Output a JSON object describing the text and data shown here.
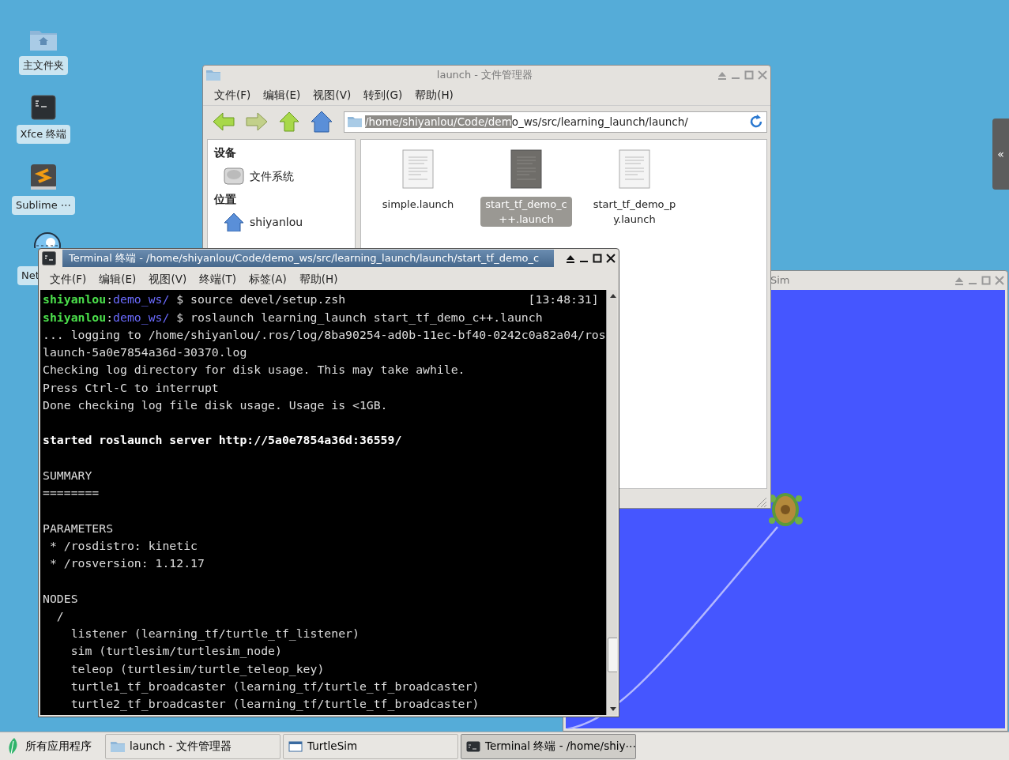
{
  "desktop_icons": [
    {
      "label": "主文件夹",
      "kind": "home"
    },
    {
      "label": "Xfce 终端",
      "kind": "terminal"
    },
    {
      "label": "Sublime ⋯",
      "kind": "sublime"
    },
    {
      "label": "Net",
      "kind": "network"
    }
  ],
  "panel_toggle": "«",
  "file_manager": {
    "title": "launch - 文件管理器",
    "menu": [
      "文件(F)",
      "编辑(E)",
      "视图(V)",
      "转到(G)",
      "帮助(H)"
    ],
    "path_selected": "/home/shiyanlou/Code/dem",
    "path_rest": "o_ws/src/learning_launch/launch/",
    "sidebar": [
      {
        "heading": "设备",
        "items": [
          {
            "label": "文件系统",
            "kind": "drive"
          }
        ]
      },
      {
        "heading": "位置",
        "items": [
          {
            "label": "shiyanlou",
            "kind": "home"
          }
        ]
      }
    ],
    "files": [
      {
        "name": "simple.launch",
        "selected": false
      },
      {
        "name": "start_tf_demo_c++.launch",
        "selected": true
      },
      {
        "name": "start_tf_demo_py.launch",
        "selected": false
      }
    ]
  },
  "turtlesim": {
    "title": "Sim"
  },
  "terminal": {
    "title": "Terminal 终端 - /home/shiyanlou/Code/demo_ws/src/learning_launch/launch/start_tf_demo_c",
    "menu": [
      "文件(F)",
      "编辑(E)",
      "视图(V)",
      "终端(T)",
      "标签(A)",
      "帮助(H)"
    ],
    "lines": [
      {
        "kind": "prompt",
        "user": "shiyanlou",
        "separator": ":",
        "dir": "demo_ws/",
        "command": "$ source devel/setup.zsh",
        "time": "[13:48:31]"
      },
      {
        "kind": "prompt",
        "user": "shiyanlou",
        "separator": ":",
        "dir": "demo_ws/",
        "command": "$ roslaunch learning_launch start_tf_demo_c++.launch"
      },
      {
        "kind": "text",
        "text": "... logging to /home/shiyanlou/.ros/log/8ba90254-ad0b-11ec-bf40-0242c0a82a04/ros"
      },
      {
        "kind": "text",
        "text": "launch-5a0e7854a36d-30370.log"
      },
      {
        "kind": "text",
        "text": "Checking log directory for disk usage. This may take awhile."
      },
      {
        "kind": "text",
        "text": "Press Ctrl-C to interrupt"
      },
      {
        "kind": "text",
        "text": "Done checking log file disk usage. Usage is <1GB."
      },
      {
        "kind": "blank"
      },
      {
        "kind": "bold",
        "text": "started roslaunch server http://5a0e7854a36d:36559/"
      },
      {
        "kind": "blank"
      },
      {
        "kind": "text",
        "text": "SUMMARY"
      },
      {
        "kind": "text",
        "text": "========"
      },
      {
        "kind": "blank"
      },
      {
        "kind": "text",
        "text": "PARAMETERS"
      },
      {
        "kind": "text",
        "text": " * /rosdistro: kinetic"
      },
      {
        "kind": "text",
        "text": " * /rosversion: 1.12.17"
      },
      {
        "kind": "blank"
      },
      {
        "kind": "text",
        "text": "NODES"
      },
      {
        "kind": "text",
        "text": "  /"
      },
      {
        "kind": "text",
        "text": "    listener (learning_tf/turtle_tf_listener)"
      },
      {
        "kind": "text",
        "text": "    sim (turtlesim/turtlesim_node)"
      },
      {
        "kind": "text",
        "text": "    teleop (turtlesim/turtle_teleop_key)"
      },
      {
        "kind": "text",
        "text": "    turtle1_tf_broadcaster (learning_tf/turtle_tf_broadcaster)"
      },
      {
        "kind": "text",
        "text": "    turtle2_tf_broadcaster (learning_tf/turtle_tf_broadcaster)"
      }
    ]
  },
  "taskbar": {
    "start": "所有应用程序",
    "tasks": [
      {
        "label": "launch - 文件管理器",
        "kind": "folder",
        "selected": false
      },
      {
        "label": "TurtleSim",
        "kind": "window",
        "selected": false
      },
      {
        "label": "Terminal 终端 - /home/shiy⋯",
        "kind": "terminal",
        "selected": true
      }
    ]
  }
}
